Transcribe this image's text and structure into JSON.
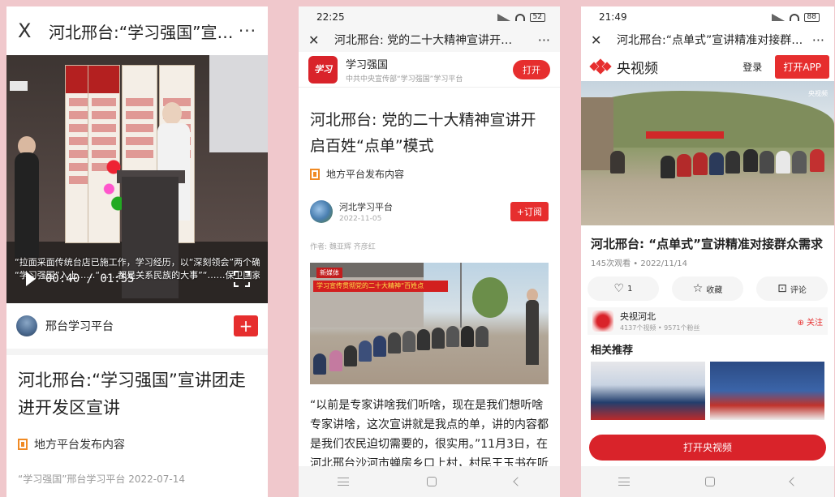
{
  "phone1": {
    "nav": {
      "close": "X",
      "title": "河北邢台:“学习强国”宣讲团走进开…",
      "more": "···"
    },
    "video": {
      "subtitle_line1": "“拉面采面传统台店已施工作，学习经历，以“深刻领会”两个确立”的决定性意义",
      "subtitle_line2": "“学习强国”入上……“……都是关系民族的大事”“……保卫国家安全”等为题进行宣讲",
      "time": "00:40 / 01:55"
    },
    "account": {
      "name": "邢台学习平台",
      "add": "+"
    },
    "headline": "河北邢台:“学习强国”宣讲团走进开发区宣讲",
    "source": "地方平台发布内容",
    "meta": "“学习强国”邢台学习平台 2022-07-14"
  },
  "phone2": {
    "status": {
      "time": "22:25",
      "battery": "52"
    },
    "nav": {
      "close": "✕",
      "title": "河北邢台: 党的二十大精神宣讲开…",
      "more": "···"
    },
    "app": {
      "logo": "学习",
      "name": "学习强国",
      "desc": "中共中央宣传部“学习强国”学习平台",
      "open": "打开"
    },
    "headline": "河北邢台: 党的二十大精神宣讲开启百姓“点单”模式",
    "source": "地方平台发布内容",
    "account": {
      "name": "河北学习平台",
      "date": "2022-11-05",
      "subscribe": "+订阅"
    },
    "author": "作者: 魏亚辉 齐彦红",
    "photo": {
      "tag": "新媒体",
      "banner": "学习宣传贯彻党的二十大精神“百姓点单”"
    },
    "paragraph": "“以前是专家讲啥我们听啥，现在是我们想听啥专家讲啥，这次宣讲就是我点的单，讲的内容都是我们农民迫切需要的，很实用。”11月3日，在河北邢台沙河市蝉房乡口上村，村民王玉书在听完宣讲后由衷地对记者说道"
  },
  "phone3": {
    "status": {
      "time": "21:49",
      "battery": "88"
    },
    "nav": {
      "close": "✕",
      "title": "河北邢台:“点单式”宣讲精准对接群…",
      "more": "···"
    },
    "header": {
      "logo": "央视频",
      "login": "登录",
      "open": "打开APP"
    },
    "photo_wm": "央视频",
    "headline": "河北邢台: “点单式”宣讲精准对接群众需求",
    "views": "145次观看 • 2022/11/14",
    "actions": {
      "like_icon": "heart-icon",
      "like_count": "1",
      "fav_icon": "star-icon",
      "fav_label": "收藏",
      "comment_icon": "comment-icon",
      "comment_label": "评论"
    },
    "channel": {
      "name": "央视河北",
      "stats": "4137个视频 • 9571个粉丝",
      "follow": "关注"
    },
    "related": "相关推荐",
    "cta": "打开央视频"
  },
  "colors": {
    "accent": "#e62e2e",
    "background": "#f0c8cc"
  }
}
